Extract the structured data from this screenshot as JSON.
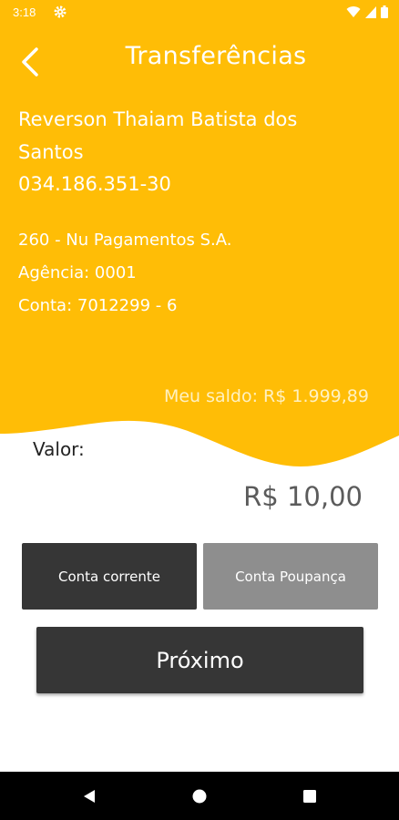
{
  "colors": {
    "header": "#FFBD06",
    "dark_button": "#363636",
    "grey_button": "#8E8E8E"
  },
  "status_bar": {
    "time": "3:18"
  },
  "header": {
    "title": "Transferências",
    "back_icon": "chevron-left-icon"
  },
  "recipient": {
    "name": "Reverson Thaiam Batista dos Santos",
    "cpf": "034.186.351-30",
    "bank": "260 - Nu Pagamentos S.A.",
    "agency": "Agência: 0001",
    "account": "Conta: 7012299 - 6"
  },
  "balance": "Meu saldo: R$ 1.999,89",
  "transfer": {
    "value_label": "Valor:",
    "value": "R$ 10,00"
  },
  "account_type": {
    "checking_label": "Conta corrente",
    "savings_label": "Conta Poupança",
    "selected": "Conta corrente"
  },
  "next_button": "Próximo",
  "nav": {
    "back_icon": "triangle-back-icon",
    "home_icon": "circle-home-icon",
    "recents_icon": "square-recents-icon"
  }
}
